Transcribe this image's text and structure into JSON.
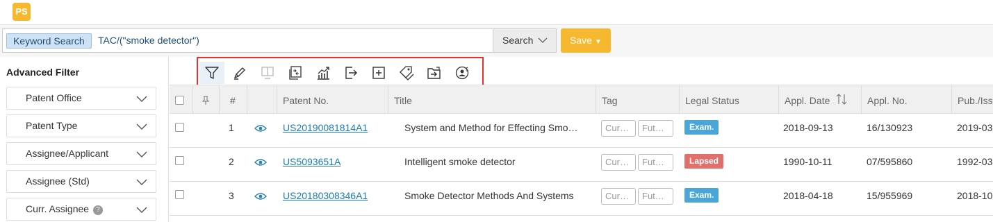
{
  "app": {
    "logo_text": "PS"
  },
  "search": {
    "mode_label": "Keyword Search",
    "query": "TAC/(\"smoke detector\")",
    "search_label": "Search",
    "save_label": "Save"
  },
  "sidebar": {
    "title": "Advanced Filter",
    "filters": [
      {
        "label": "Patent Office"
      },
      {
        "label": "Patent Type"
      },
      {
        "label": "Assignee/Applicant"
      },
      {
        "label": "Assignee (Std)"
      },
      {
        "label": "Curr. Assignee",
        "help": "?"
      }
    ]
  },
  "toolbar": {
    "tools": [
      {
        "icon": "filter-icon",
        "active": true
      },
      {
        "icon": "highlight-pen-icon"
      },
      {
        "icon": "monitor-icon",
        "disabled": true
      },
      {
        "icon": "compare-icon"
      },
      {
        "icon": "analytics-chart-icon"
      },
      {
        "icon": "export-icon"
      },
      {
        "icon": "add-icon"
      },
      {
        "icon": "tag-icon"
      },
      {
        "icon": "folder-move-icon"
      },
      {
        "icon": "monitor-user-icon"
      }
    ]
  },
  "table": {
    "columns": {
      "num": "#",
      "patent_no": "Patent No.",
      "title": "Title",
      "tag": "Tag",
      "legal_status": "Legal Status",
      "appl_date": "Appl. Date",
      "appl_no": "Appl. No.",
      "pub": "Pub./Iss"
    },
    "rows": [
      {
        "num": "1",
        "patent_no": "US20190081814A1",
        "title": "System and Method for Effecting Smo…",
        "tag_curr": "Cur…",
        "tag_fut": "Fut…",
        "status": "Exam.",
        "appl_date": "2018-09-13",
        "appl_no": "16/130923",
        "pub": "2019-03"
      },
      {
        "num": "2",
        "patent_no": "US5093651A",
        "title": "Intelligent smoke detector",
        "tag_curr": "Cur…",
        "tag_fut": "Fut…",
        "status": "Lapsed",
        "appl_date": "1990-10-11",
        "appl_no": "07/595860",
        "pub": "1992-03"
      },
      {
        "num": "3",
        "patent_no": "US20180308346A1",
        "title": "Smoke Detector Methods And Systems",
        "tag_curr": "Cur…",
        "tag_fut": "Fut…",
        "status": "Exam.",
        "appl_date": "2018-04-18",
        "appl_no": "15/955969",
        "pub": "2018-10"
      }
    ]
  },
  "colors": {
    "brand": "#f5b82e",
    "link": "#1a7bb5",
    "status_exam": "#4aa6d9",
    "status_lapsed": "#e0706b",
    "highlight_border": "#e8302a"
  }
}
